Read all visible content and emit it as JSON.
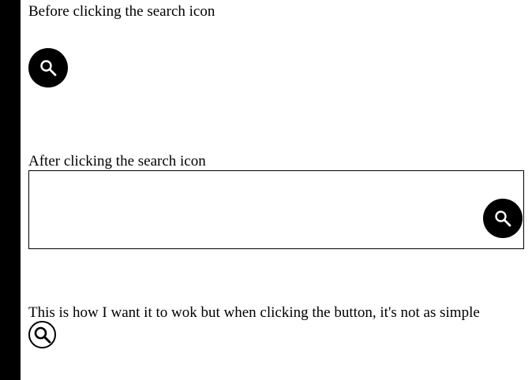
{
  "labels": {
    "before": "Before clicking the search icon",
    "after": "After clicking the search icon",
    "note": "This is how I want it to wok but when clicking the button, it's not as simple"
  },
  "search_box": {
    "value": "",
    "placeholder": ""
  },
  "icons": {
    "before_button": "search-icon",
    "after_button": "search-icon",
    "outline_button": "search-icon"
  },
  "colors": {
    "background": "#ffffff",
    "left_bar": "#000000",
    "button_fill": "#000000",
    "icon_on_button": "#ffffff",
    "text": "#000000"
  }
}
